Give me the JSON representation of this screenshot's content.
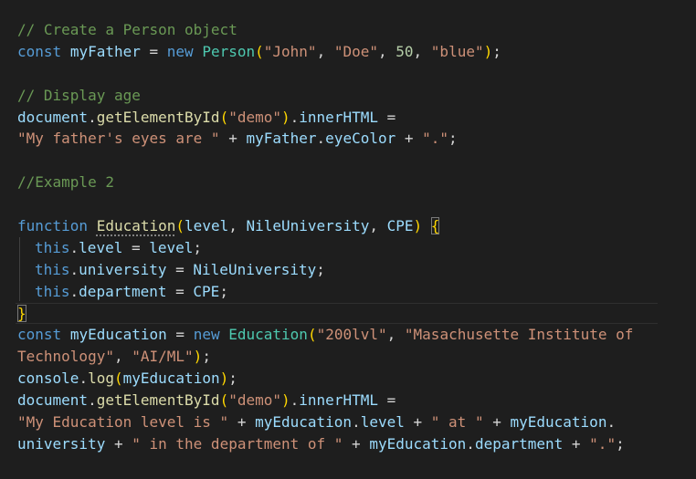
{
  "editor": {
    "theme": {
      "background": "#1e1e1e",
      "comment": "#6a9955",
      "keyword": "#569cd6",
      "variable": "#9cdcfe",
      "function": "#dcdcaa",
      "type": "#4ec9b0",
      "string": "#ce9178",
      "number": "#b5cea8",
      "bracket_gold": "#ffd700",
      "bracket_orchid": "#da70d6"
    },
    "code": {
      "l1": {
        "comment": "// Create a Person object"
      },
      "l2": {
        "kw": "const",
        "var": "myFather",
        "eq": " = ",
        "kw_new": "new",
        "cls": "Person",
        "open": "(",
        "a1": "\"John\"",
        "sep1": ", ",
        "a2": "\"Doe\"",
        "sep2": ", ",
        "a3": "50",
        "sep3": ", ",
        "a4": "\"blue\"",
        "close": ")",
        "semi": ";"
      },
      "l4": {
        "comment": "// Display age"
      },
      "l5": {
        "obj": "document",
        "dot": ".",
        "fn": "getElementById",
        "open": "(",
        "arg": "\"demo\"",
        "close": ")",
        "dot2": ".",
        "prop": "innerHTML",
        "eq": " ="
      },
      "l6": {
        "str1": "\"My father's eyes are \"",
        "plus1": " + ",
        "obj": "myFather",
        "dot": ".",
        "prop": "eyeColor",
        "plus2": " + ",
        "str2": "\".\"",
        "semi": ";"
      },
      "l8": {
        "comment": "//Example 2"
      },
      "l10": {
        "kw": "function",
        "fn": "Education",
        "open": "(",
        "p1": "level",
        "sep1": ", ",
        "p2": "NileUniversity",
        "sep2": ", ",
        "p3": "CPE",
        "close": ")",
        "brace": "{"
      },
      "l11": {
        "this": "this",
        "dot": ".",
        "prop": "level",
        "eq": " = ",
        "val": "level",
        "semi": ";"
      },
      "l12": {
        "this": "this",
        "dot": ".",
        "prop": "university",
        "eq": " = ",
        "val": "NileUniversity",
        "semi": ";"
      },
      "l13": {
        "this": "this",
        "dot": ".",
        "prop": "department",
        "eq": " = ",
        "val": "CPE",
        "semi": ";"
      },
      "l14": {
        "brace": "}"
      },
      "l15": {
        "kw": "const",
        "var": "myEducation",
        "eq": " = ",
        "kw_new": "new",
        "cls": "Education",
        "open": "(",
        "a1": "\"200lvl\"",
        "sep1": ", ",
        "a2": "\"Masachusette Institute of"
      },
      "l16": {
        "a2cont": "Technology\"",
        "sep": ", ",
        "a3": "\"AI/ML\"",
        "close": ")",
        "semi": ";"
      },
      "l17": {
        "obj": "console",
        "dot": ".",
        "fn": "log",
        "open": "(",
        "arg": "myEducation",
        "close": ")",
        "semi": ";"
      },
      "l18": {
        "obj": "document",
        "dot": ".",
        "fn": "getElementById",
        "open": "(",
        "arg": "\"demo\"",
        "close": ")",
        "dot2": ".",
        "prop": "innerHTML",
        "eq": " ="
      },
      "l19": {
        "str1": "\"My Education level is \"",
        "plus1": " + ",
        "obj1": "myEducation",
        "dot1": ".",
        "prop1": "level",
        "plus2": " + ",
        "str2": "\" at \"",
        "plus3": " + ",
        "obj2": "myEducation",
        "dot2": "."
      },
      "l20": {
        "prop2": "university",
        "plus4": " + ",
        "str3": "\" in the department of \"",
        "plus5": " + ",
        "obj3": "myEducation",
        "dot3": ".",
        "prop3": "department",
        "plus6": " + ",
        "str4": "\".\"",
        "semi": ";"
      }
    }
  }
}
